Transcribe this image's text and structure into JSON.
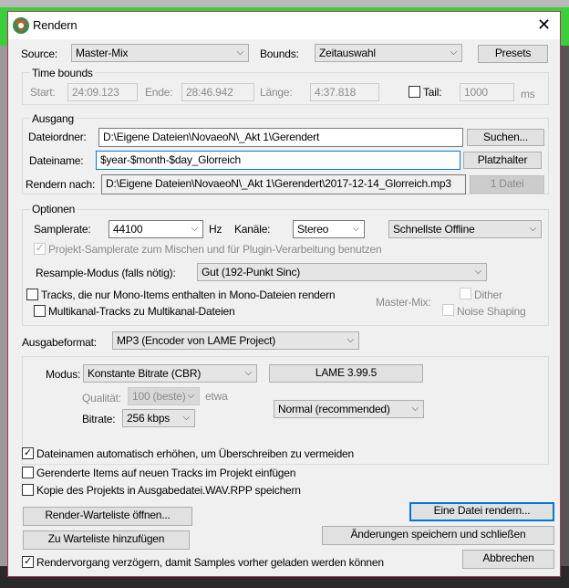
{
  "window": {
    "title": "Rendern",
    "close_icon": "close-icon",
    "app_icon": "reaper-logo-icon"
  },
  "source": {
    "label": "Source:",
    "value": "Master-Mix"
  },
  "bounds": {
    "label": "Bounds:",
    "value": "Zeitauswahl"
  },
  "presets_label": "Presets",
  "time_bounds": {
    "title": "Time bounds",
    "start_label": "Start:",
    "start": "24:09.123",
    "end_label": "Ende:",
    "end": "28:46.942",
    "length_label": "Länge:",
    "length": "4:37.818",
    "tail_label": "Tail:",
    "tail_checked": false,
    "tail": "1000",
    "tail_unit": "ms"
  },
  "output": {
    "title": "Ausgang",
    "folder_label": "Dateiordner:",
    "folder": "D:\\Eigene Dateien\\NovaeoN\\_Akt 1\\Gerendert",
    "browse_label": "Suchen...",
    "filename_label": "Dateiname:",
    "filename": "$year-$month-$day_Glorreich",
    "placeholder_label": "Platzhalter",
    "render_to_label": "Rendern nach:",
    "render_to": "D:\\Eigene Dateien\\NovaeoN\\_Akt 1\\Gerendert\\2017-12-14_Glorreich.mp3",
    "files_label": "1 Datei"
  },
  "options": {
    "title": "Optionen",
    "samplerate_label": "Samplerate:",
    "samplerate": "44100",
    "hz": "Hz",
    "channels_label": "Kanäle:",
    "channels": "Stereo",
    "speed": "Schnellste Offline",
    "project_sr_label": "Projekt-Samplerate zum Mischen und für Plugin-Verarbeitung benutzen",
    "resample_label": "Resample-Modus (falls nötig):",
    "resample": "Gut (192-Punkt Sinc)",
    "mono_label": "Tracks, die nur Mono-Items enthalten in Mono-Dateien rendern",
    "multichannel_label": "Multikanal-Tracks zu Multikanal-Dateien",
    "master_mix_label": "Master-Mix:",
    "dither_label": "Dither",
    "noise_shaping_label": "Noise Shaping"
  },
  "format": {
    "label": "Ausgabeformat:",
    "value": "MP3 (Encoder von LAME Project)",
    "mode_label": "Modus:",
    "mode": "Konstante Bitrate (CBR)",
    "lame_label": "LAME 3.99.5",
    "quality_label": "Qualität:",
    "quality": "100 (beste)",
    "approx": "etwa",
    "bitrate_label": "Bitrate:",
    "bitrate": "256 kbps",
    "preset": "Normal (recommended)"
  },
  "checks": [
    {
      "label": "Dateinamen automatisch erhöhen, um Überschreiben zu vermeiden",
      "checked": true
    },
    {
      "label": "Gerenderte Items auf neuen Tracks im Projekt einfügen",
      "checked": false
    },
    {
      "label": "Kopie des Projekts in Ausgabedatei.WAV.RPP speichern",
      "checked": false
    }
  ],
  "delay_check": {
    "label": "Rendervorgang verzögern, damit Samples vorher geladen werden können",
    "checked": true
  },
  "buttons": {
    "queue_open": "Render-Warteliste öffnen...",
    "queue_add": "Zu Warteliste hinzufügen",
    "render": "Eine Datei rendern...",
    "save_close": "Änderungen speichern und schließen",
    "cancel": "Abbrechen"
  },
  "check_glyph": "✓",
  "chevron": "⌵"
}
